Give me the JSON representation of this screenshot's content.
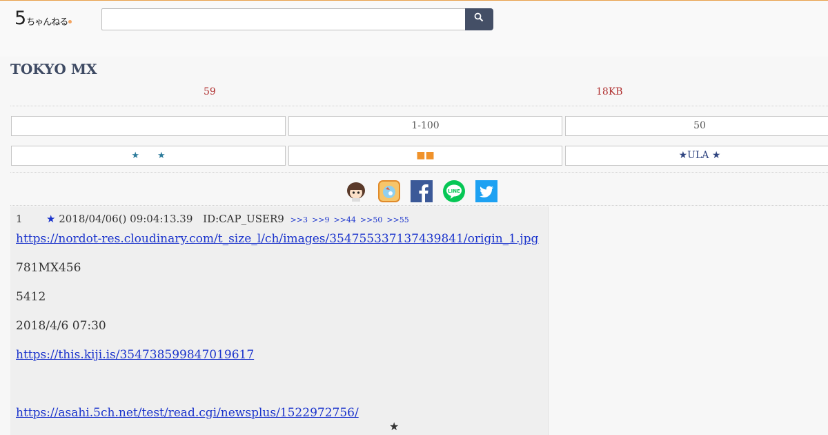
{
  "header": {
    "logo": {
      "digit": "5",
      "kana": "ちゃんねる"
    },
    "search": {
      "value": "",
      "placeholder": ""
    }
  },
  "board": {
    "title": "TOKYO MX",
    "stats": {
      "res_count": "59",
      "size": "18KB"
    }
  },
  "nav_row1": [
    "",
    "1-100",
    "50"
  ],
  "nav_row2": [
    "★　　★",
    "■■",
    "★ULA ★"
  ],
  "share_icons": [
    "character-icon",
    "app-icon",
    "facebook-icon",
    "line-icon",
    "twitter-icon"
  ],
  "share": {
    "line_text": "LINE"
  },
  "post": {
    "number": "1",
    "name_star": "★",
    "datetime": "2018/04/06() 09:04:13.39",
    "id": "ID:CAP_USER9",
    "reply_links": [
      ">>3",
      ">>9",
      ">>44",
      ">>50",
      ">>55"
    ],
    "lines": [
      "https://nordot-res.cloudinary.com/t_size_l/ch/images/354755337137439841/origin_1.jpg",
      "781MX456",
      "5412",
      "2018/4/6 07:30",
      "https://this.kiji.is/354738599847019617",
      "https://asahi.5ch.net/test/read.cgi/newsplus/1522972756/"
    ],
    "trailing_star": "★"
  },
  "colors": {
    "accent_top": "#e8a04a",
    "search_button": "#444f66",
    "title": "#3e4a63",
    "stat_red": "#b03030",
    "link_blue": "#1a33cc",
    "facebook": "#3b5998",
    "line": "#06c755",
    "twitter": "#1da1f2"
  }
}
